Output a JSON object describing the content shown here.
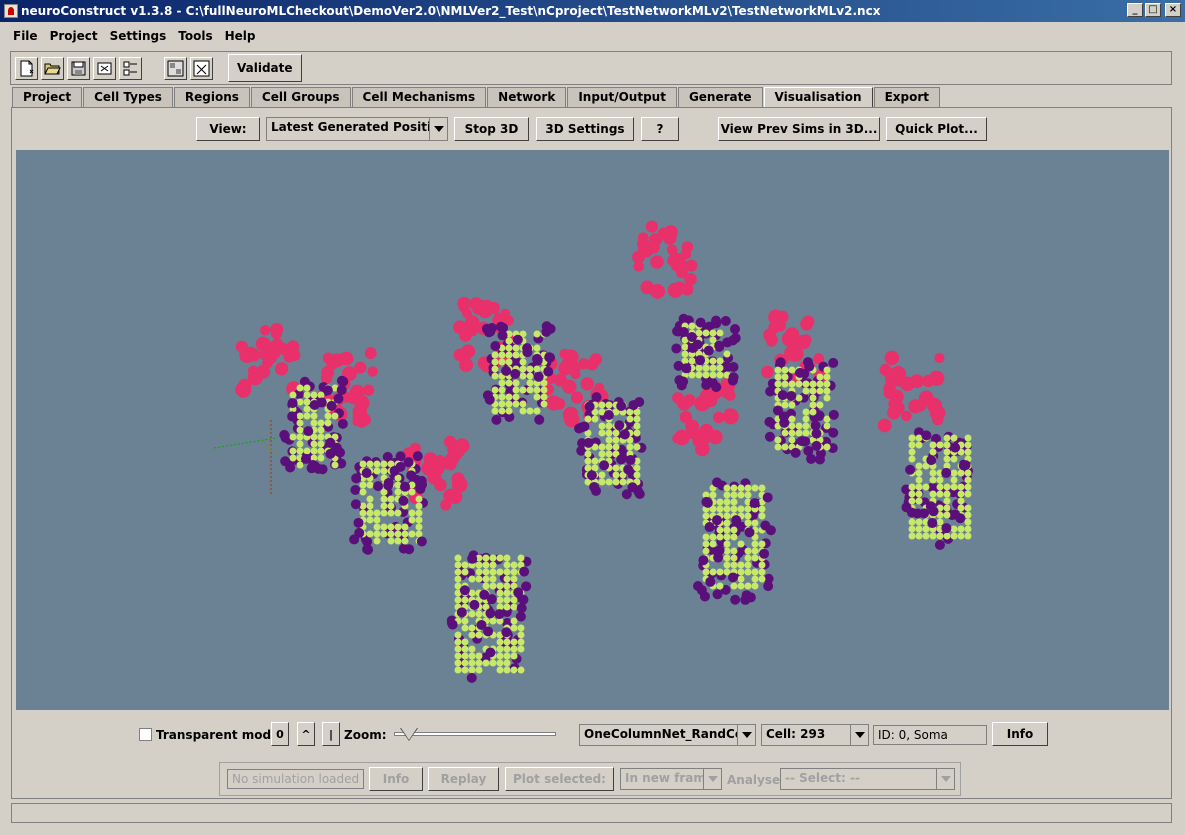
{
  "window": {
    "title": "neuroConstruct v1.3.8 - C:\\fullNeuroMLCheckout\\DemoVer2.0\\NMLVer2_Test\\nCproject\\TestNetworkMLv2\\TestNetworkMLv2.ncx",
    "minimize_label": "_",
    "maximize_label": "□",
    "close_label": "×"
  },
  "menu": {
    "items": [
      "File",
      "Project",
      "Settings",
      "Tools",
      "Help"
    ]
  },
  "toolbar": {
    "icons": [
      "new-project-icon",
      "open-project-icon",
      "save-project-icon",
      "close-project-icon",
      "preferences-icon",
      "generate-icon",
      "close-all-icon"
    ],
    "validate_label": "Validate"
  },
  "tabs": {
    "items": [
      "Project",
      "Cell Types",
      "Regions",
      "Cell Groups",
      "Cell Mechanisms",
      "Network",
      "Input/Output",
      "Generate",
      "Visualisation",
      "Export"
    ],
    "active": "Visualisation"
  },
  "vis_controls": {
    "view_label": "View:",
    "view_selected": "Latest Generated Positions",
    "stop3d_label": "Stop 3D",
    "settings3d_label": "3D Settings",
    "help_label": "?",
    "view_prev_label": "View Prev Sims in 3D...",
    "quick_plot_label": "Quick Plot..."
  },
  "scene": {
    "background": "#6a8294",
    "pink_color": "#e8306a",
    "purple_color": "#5a0f7a",
    "yellow_color": "#c8e86a",
    "axes_colors": [
      "#00aa00",
      "#aa3300",
      "#888800"
    ]
  },
  "bottom": {
    "transparent_mode_label": "Transparent mode",
    "transparent_checked": false,
    "btn_zero": "0",
    "btn_up": "^",
    "btn_bar": "|",
    "zoom_label": "Zoom:",
    "zoom_fraction": 0.05,
    "network_selected": "OneColumnNet_RandCells",
    "cell_selected": "Cell: 293",
    "segment_info": "ID: 0, Soma",
    "info_label": "Info",
    "sim_placeholder": "No simulation loaded",
    "sim_info_label": "Info",
    "replay_label": "Replay",
    "plot_selected_label": "Plot selected:",
    "plot_target": "In new frame",
    "analyse_label": "Analyse:",
    "analyse_selected": "-- Select: --"
  }
}
